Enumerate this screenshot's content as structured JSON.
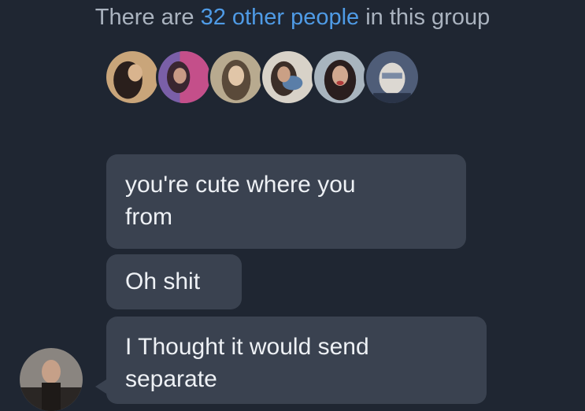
{
  "group": {
    "prefix": "There are ",
    "link": "32 other people",
    "suffix": " in this group"
  },
  "avatars": [
    {
      "name": "member-avatar",
      "bg": "#c9a57a",
      "fg": "#2a1f1c"
    },
    {
      "name": "member-avatar",
      "bg": "#7a5fa8",
      "fg": "#3a2630"
    },
    {
      "name": "member-avatar",
      "bg": "#b8aa8f",
      "fg": "#5a4a3a"
    },
    {
      "name": "member-avatar",
      "bg": "#d8d2c8",
      "fg": "#3b2e28"
    },
    {
      "name": "member-avatar",
      "bg": "#a8b4be",
      "fg": "#2a1e1e"
    },
    {
      "name": "member-avatar",
      "bg": "#4f5d78",
      "fg": "#dcd8d2"
    }
  ],
  "messages": [
    {
      "line1": "you're cute where you",
      "line2": "from"
    },
    {
      "line1": "Oh shit"
    },
    {
      "line1": "I Thought it would send",
      "line2": "separate"
    }
  ]
}
